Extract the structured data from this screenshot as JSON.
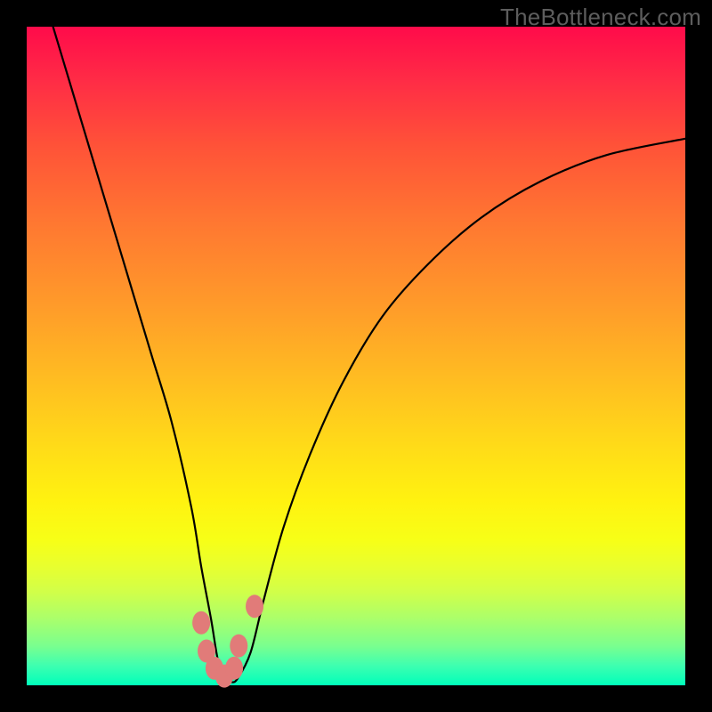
{
  "watermark": "TheBottleneck.com",
  "chart_data": {
    "type": "line",
    "title": "",
    "xlabel": "",
    "ylabel": "",
    "xlim": [
      0,
      100
    ],
    "ylim": [
      0,
      100
    ],
    "grid": false,
    "legend": false,
    "series": [
      {
        "name": "bottleneck-curve",
        "x": [
          4,
          7,
          10,
          13,
          16,
          19,
          22,
          25,
          26.5,
          28,
          29,
          30,
          31,
          32,
          34,
          36,
          39,
          43,
          48,
          54,
          61,
          69,
          78,
          88,
          100
        ],
        "y": [
          100,
          90,
          80,
          70,
          60,
          50,
          40,
          27,
          18,
          10,
          4,
          1,
          0.5,
          1,
          5,
          13,
          24,
          35,
          46,
          56,
          64,
          71,
          76.5,
          80.5,
          83
        ]
      }
    ],
    "markers": [
      {
        "x": 26.5,
        "y": 9.5
      },
      {
        "x": 27.3,
        "y": 5.2
      },
      {
        "x": 28.5,
        "y": 2.6
      },
      {
        "x": 30.0,
        "y": 1.4
      },
      {
        "x": 31.5,
        "y": 2.6
      },
      {
        "x": 32.2,
        "y": 6.0
      },
      {
        "x": 34.6,
        "y": 12.0
      }
    ],
    "marker_color": "#e17b79",
    "curve_color": "#000000",
    "background_gradient": [
      "#ff0b4a",
      "#ffdc18",
      "#00ffba"
    ]
  }
}
